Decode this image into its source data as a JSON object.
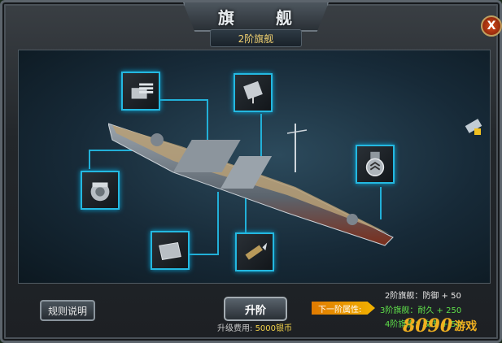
{
  "window": {
    "title": "旗 舰",
    "subtitle": "2阶旗舰",
    "close_label": "X"
  },
  "buttons": {
    "rules_label": "规则说明",
    "upgrade_label": "升阶"
  },
  "cost": {
    "label": "升级费用:",
    "value": "5000银币"
  },
  "attributes": {
    "current": "2阶旗舰：防御 + 50",
    "next_label": "下一阶属性:",
    "next_line_1": "3阶旗舰：耐久 + 250",
    "next_line_2": "4阶旗舰：攻击 + 50"
  },
  "slots": [
    {
      "icon": "turret-icon"
    },
    {
      "icon": "radar-icon"
    },
    {
      "icon": "engine-icon"
    },
    {
      "icon": "medal-icon"
    },
    {
      "icon": "armor-plate-icon"
    },
    {
      "icon": "shell-icon"
    }
  ],
  "watermark": {
    "number": "8090",
    "text": "游戏"
  },
  "colors": {
    "slot_border": "#24b8e0",
    "accent_orange": "#f2b200",
    "green_text": "#5fe04a",
    "gold_text": "#f3d24a"
  }
}
